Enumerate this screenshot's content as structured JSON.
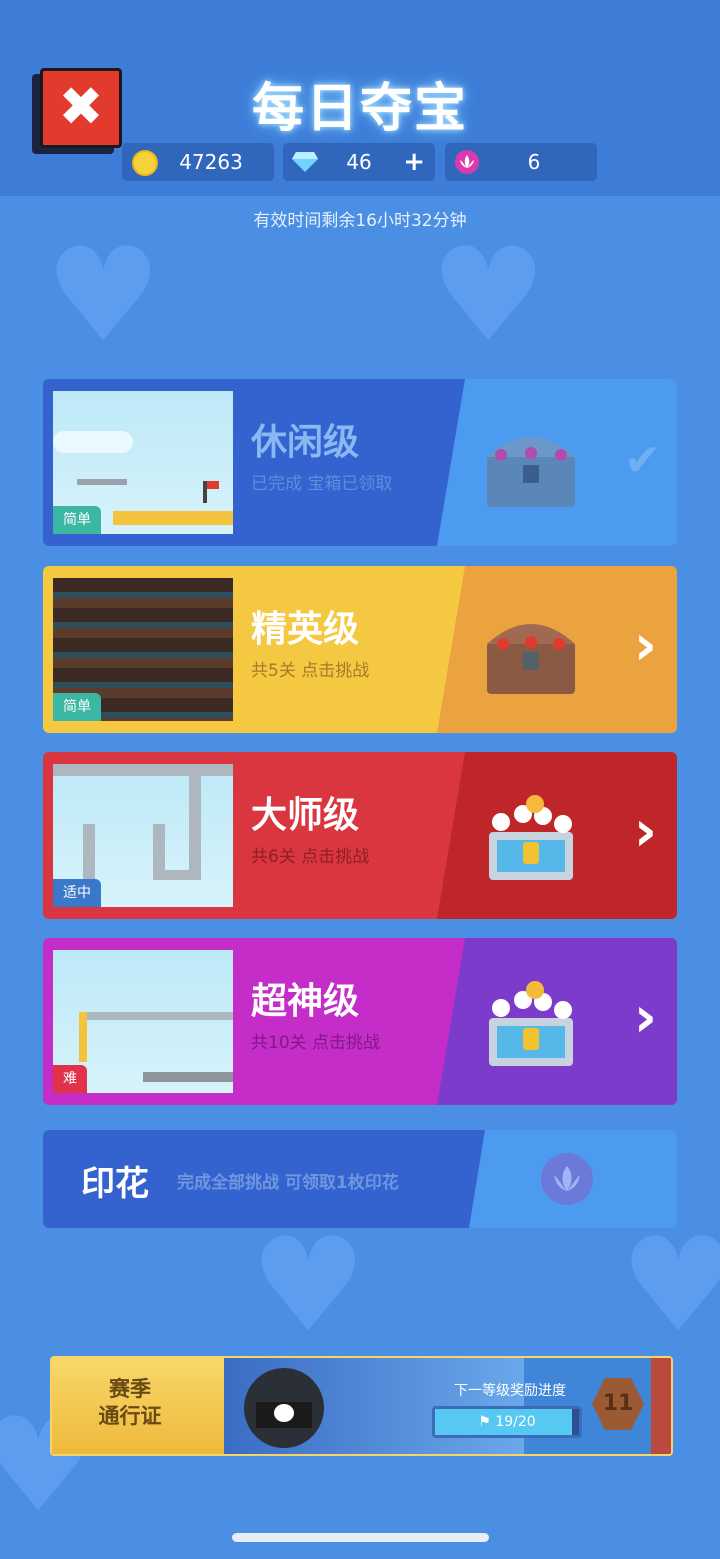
{
  "header": {
    "title": "每日夺宝",
    "close_icon": "close-icon",
    "coins": {
      "icon": "coin-icon",
      "value": "47263"
    },
    "gems": {
      "icon": "diamond-icon",
      "value": "46",
      "plus": "+"
    },
    "stamps": {
      "icon": "lotus-stamp-icon",
      "value": "6"
    }
  },
  "timer_text": "有效时间剩余16小时32分钟",
  "levels": [
    {
      "name": "休闲级",
      "status": "已完成 宝箱已领取",
      "tag": "简单",
      "action_icon": "check-icon",
      "action_glyph": "✔"
    },
    {
      "name": "精英级",
      "status": "共5关 点击挑战",
      "tag": "简单",
      "action_icon": "chevron-right-icon",
      "action_glyph": "›"
    },
    {
      "name": "大师级",
      "status": "共6关 点击挑战",
      "tag": "适中",
      "action_icon": "chevron-right-icon",
      "action_glyph": "›"
    },
    {
      "name": "超神级",
      "status": "共10关 点击挑战",
      "tag": "难",
      "action_icon": "chevron-right-icon",
      "action_glyph": "›"
    }
  ],
  "stamp_row": {
    "title": "印花",
    "desc": "完成全部挑战 可领取1枚印花",
    "icon": "lotus-stamp-icon"
  },
  "season_pass": {
    "label_line1": "赛季",
    "label_line2": "通行证",
    "progress_label": "下一等级奖励进度",
    "progress_text": "19/20",
    "progress": 0.95,
    "level": "11"
  },
  "colors": {
    "background": "#4a8fe3",
    "header": "#3d7dd8",
    "casual": "#3462cf",
    "elite": "#f5c842",
    "master": "#d9363f",
    "god": "#c52dc8"
  }
}
